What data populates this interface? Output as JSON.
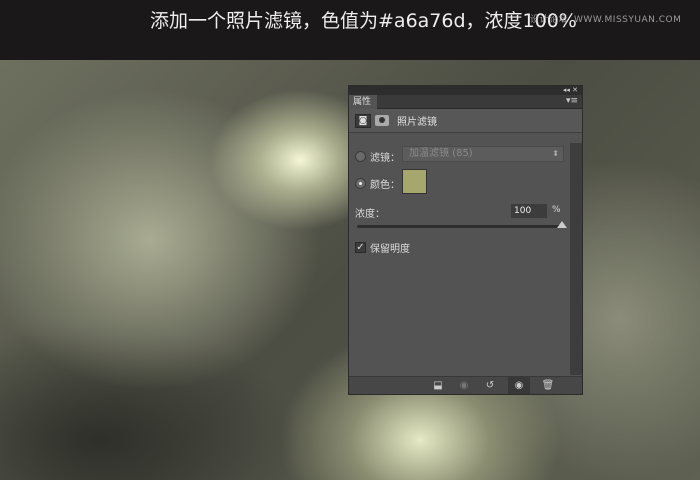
{
  "caption": "添加一个照片滤镜，色值为#a6a76d，浓度100%",
  "watermark": {
    "cn": "设计论坛",
    "url": "WWW.MISSYUAN.COM"
  },
  "panel": {
    "collapse": "◂◂ ✕",
    "tab": "属性",
    "menu": "▾≡",
    "header_title": "照片滤镜",
    "filter_label": "滤镜：",
    "filter_value": "加温滤镜 (85)",
    "color_label": "颜色：",
    "color_hex": "#a6a76d",
    "density_label": "浓度：",
    "density_value": "100",
    "density_unit": "%",
    "density_percent": 100,
    "preserve_label": "保留明度",
    "preserve_checked": true,
    "selected_mode": "color"
  },
  "footer_icons": [
    "clip-to-layer-icon",
    "view-previous-state-icon",
    "reset-icon",
    "visibility-eye-icon",
    "trash-icon"
  ]
}
